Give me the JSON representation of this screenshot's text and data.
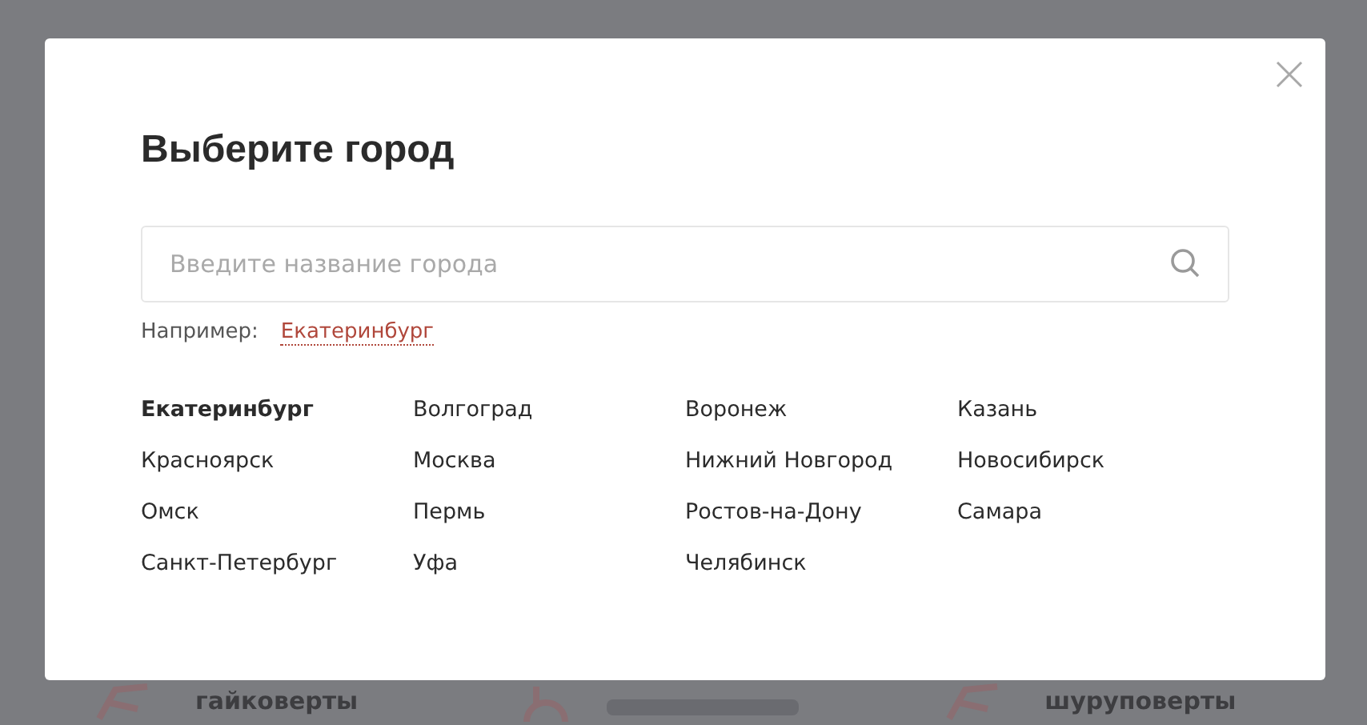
{
  "background_page": {
    "products": [
      {
        "label": "гайковерты"
      },
      {
        "label": "шуруповерты"
      }
    ]
  },
  "dialog": {
    "title": "Выберите город",
    "search": {
      "placeholder": "Введите название города"
    },
    "example": {
      "label": "Например:",
      "link": "Екатеринбург"
    },
    "city_columns": [
      [
        {
          "name": "Екатеринбург",
          "selected": true
        },
        {
          "name": "Красноярск",
          "selected": false
        },
        {
          "name": "Омск",
          "selected": false
        },
        {
          "name": "Санкт-Петербург",
          "selected": false
        }
      ],
      [
        {
          "name": "Волгоград",
          "selected": false
        },
        {
          "name": "Москва",
          "selected": false
        },
        {
          "name": "Пермь",
          "selected": false
        },
        {
          "name": "Уфа",
          "selected": false
        }
      ],
      [
        {
          "name": "Воронеж",
          "selected": false
        },
        {
          "name": "Нижний Новгород",
          "selected": false
        },
        {
          "name": "Ростов-на-Дону",
          "selected": false
        },
        {
          "name": "Челябинск",
          "selected": false
        }
      ],
      [
        {
          "name": "Казань",
          "selected": false
        },
        {
          "name": "Новосибирск",
          "selected": false
        },
        {
          "name": "Самара",
          "selected": false
        }
      ]
    ]
  }
}
